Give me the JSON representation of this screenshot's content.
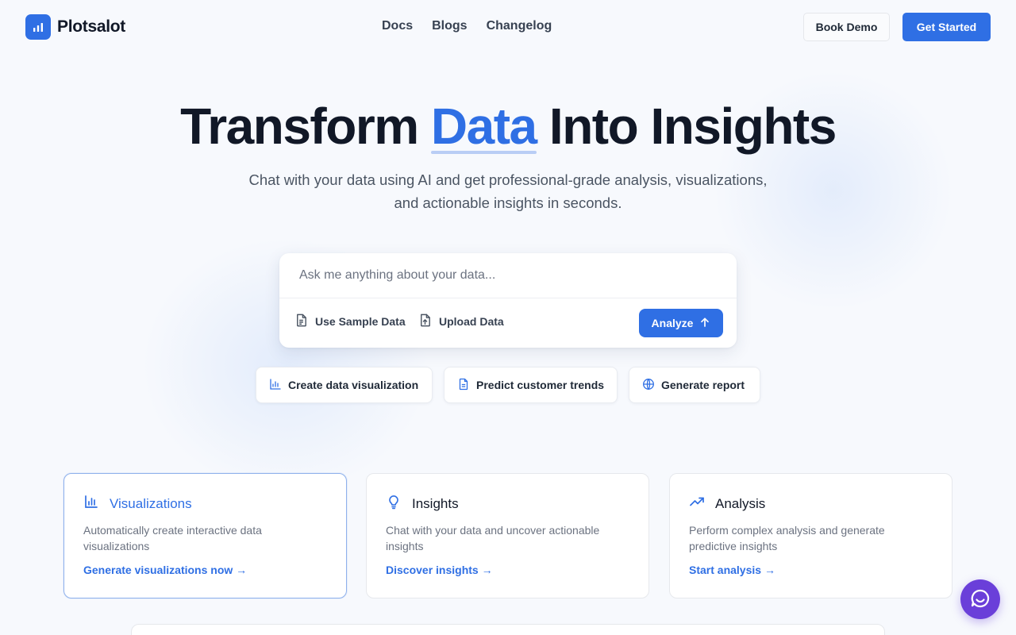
{
  "brand": {
    "name": "Plotsalot",
    "accent_color": "#2f6fe4"
  },
  "nav": {
    "items": [
      "Docs",
      "Blogs",
      "Changelog"
    ]
  },
  "header_actions": {
    "book_demo": "Book Demo",
    "get_started": "Get Started"
  },
  "hero": {
    "title_before": "Transform",
    "title_accent": "Data",
    "title_after": "Into Insights",
    "subtitle_line1": "Chat with your data using AI and get professional-grade analysis, visualizations,",
    "subtitle_line2": "and actionable insights in seconds."
  },
  "chat": {
    "placeholder": "Ask me anything about your data...",
    "use_sample": "Use Sample Data",
    "upload": "Upload Data",
    "analyze": "Analyze"
  },
  "suggestions": [
    {
      "label": "Create data visualization",
      "icon": "bar-chart-icon"
    },
    {
      "label": "Predict customer trends",
      "icon": "document-icon"
    },
    {
      "label": "Generate report",
      "icon": "globe-icon"
    }
  ],
  "features": [
    {
      "title": "Visualizations",
      "description": "Automatically create interactive data visualizations",
      "link": "Generate visualizations now",
      "icon": "bar-chart-icon",
      "active": true
    },
    {
      "title": "Insights",
      "description": "Chat with your data and uncover actionable insights",
      "link": "Discover insights",
      "icon": "lightbulb-icon",
      "active": false
    },
    {
      "title": "Analysis",
      "description": "Perform complex analysis and generate predictive insights",
      "link": "Start analysis",
      "icon": "trending-up-icon",
      "active": false
    }
  ],
  "link_arrow": "→",
  "support_widget": {
    "icon": "chat-support-icon",
    "color": "#6a3fd9"
  }
}
